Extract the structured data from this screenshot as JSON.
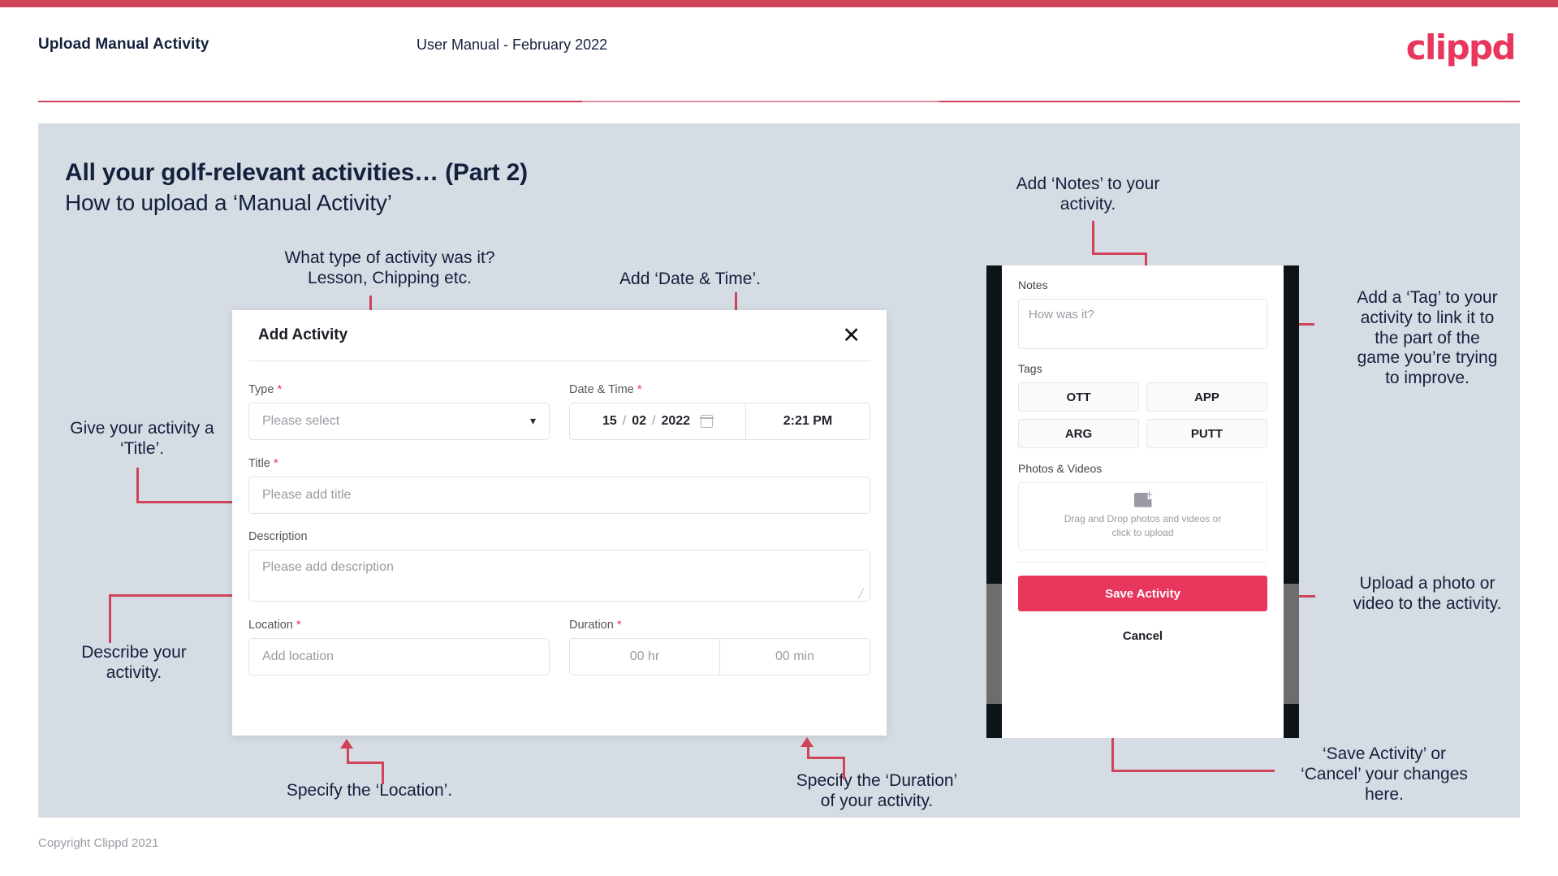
{
  "header": {
    "title": "Upload Manual Activity",
    "subtitle": "User Manual - February 2022",
    "logo": "clippd"
  },
  "slide": {
    "title": "All your golf-relevant activities… (Part 2)",
    "subtitle": "How to upload a ‘Manual Activity’"
  },
  "annotations": {
    "type": "What type of activity was it?\nLesson, Chipping etc.",
    "datetime": "Add ‘Date & Time’.",
    "title": "Give your activity a\n‘Title’.",
    "description": "Describe your\nactivity.",
    "location": "Specify the ‘Location’.",
    "duration": "Specify the ‘Duration’\nof your activity.",
    "notes": "Add ‘Notes’ to your\nactivity.",
    "tags": "Add a ‘Tag’ to your\nactivity to link it to\nthe part of the\ngame you’re trying\nto improve.",
    "upload": "Upload a photo or\nvideo to the activity.",
    "save": "‘Save Activity’ or\n‘Cancel’ your changes\nhere."
  },
  "modal": {
    "title": "Add Activity",
    "close_icon": "close-icon",
    "fields": {
      "type": {
        "label": "Type",
        "required": "*",
        "placeholder": "Please select",
        "chevron": "chevron-down-icon"
      },
      "datetime": {
        "label": "Date & Time",
        "required": "*",
        "day": "15",
        "sep1": "/",
        "month": "02",
        "sep2": "/",
        "year": "2022",
        "calendar_icon": "calendar-icon",
        "time": "2:21 PM"
      },
      "title": {
        "label": "Title",
        "required": "*",
        "placeholder": "Please add title"
      },
      "description": {
        "label": "Description",
        "placeholder": "Please add description"
      },
      "location": {
        "label": "Location",
        "required": "*",
        "placeholder": "Add location"
      },
      "duration": {
        "label": "Duration",
        "required": "*",
        "hours": "00 hr",
        "minutes": "00 min"
      }
    }
  },
  "phone": {
    "notes": {
      "label": "Notes",
      "placeholder": "How was it?"
    },
    "tags": {
      "label": "Tags",
      "items": [
        "OTT",
        "APP",
        "ARG",
        "PUTT"
      ]
    },
    "photos": {
      "label": "Photos & Videos",
      "icon": "add-image-icon",
      "drop_text": "Drag and Drop photos and videos or\nclick to upload"
    },
    "save_label": "Save Activity",
    "cancel_label": "Cancel"
  },
  "footer": {
    "copyright": "Copyright Clippd 2021"
  },
  "colors": {
    "accent": "#cf4459",
    "brand": "#e8365d",
    "navy": "#14213d",
    "slide_bg": "#d6dce4"
  }
}
